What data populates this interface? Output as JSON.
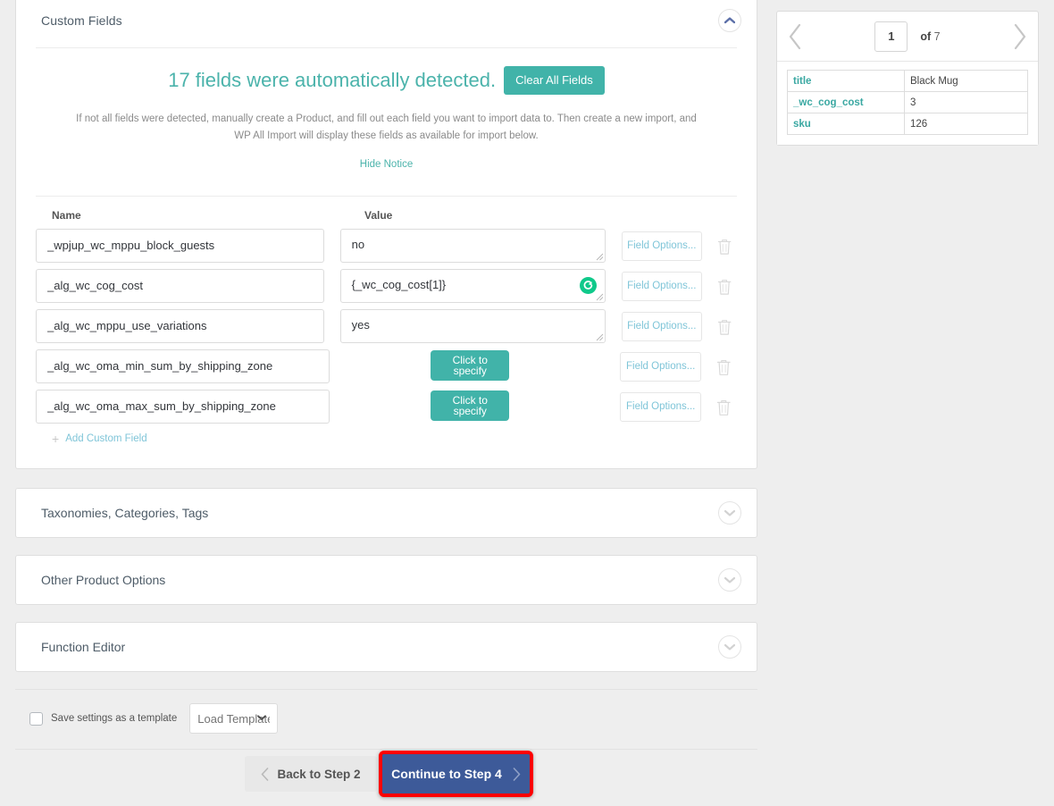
{
  "custom_fields_panel": {
    "title": "Custom Fields",
    "toggle_icon": "chevron-up-icon",
    "notice": {
      "headline": "17 fields were automatically detected.",
      "clear_button": "Clear All Fields",
      "body": "If not all fields were detected, manually create a Product, and fill out each field you want to import data to. Then create a new import, and WP All Import will display these fields as available for import below.",
      "hide_link": "Hide Notice"
    },
    "columns": {
      "name": "Name",
      "value": "Value"
    },
    "rows": [
      {
        "name": "_wpjup_wc_mppu_block_guests",
        "value_type": "textarea",
        "value": "no",
        "has_green_badge": false,
        "options_label": "Field Options...",
        "delete_icon": "trash-icon"
      },
      {
        "name": "_alg_wc_cog_cost",
        "value_type": "textarea",
        "value": "{_wc_cog_cost[1]}",
        "has_green_badge": true,
        "options_label": "Field Options...",
        "delete_icon": "trash-icon"
      },
      {
        "name": "_alg_wc_mppu_use_variations",
        "value_type": "textarea",
        "value": "yes",
        "has_green_badge": false,
        "options_label": "Field Options...",
        "delete_icon": "trash-icon"
      },
      {
        "name": "_alg_wc_oma_min_sum_by_shipping_zone",
        "value_type": "button",
        "value": "Click to specify",
        "has_green_badge": false,
        "options_label": "Field Options...",
        "delete_icon": "trash-icon"
      },
      {
        "name": "_alg_wc_oma_max_sum_by_shipping_zone",
        "value_type": "button",
        "value": "Click to specify",
        "has_green_badge": false,
        "options_label": "Field Options...",
        "delete_icon": "trash-icon"
      }
    ],
    "add_field_label": "Add Custom Field"
  },
  "collapsed_panels": [
    {
      "title": "Taxonomies, Categories, Tags",
      "toggle_icon": "chevron-down-icon"
    },
    {
      "title": "Other Product Options",
      "toggle_icon": "chevron-down-icon"
    },
    {
      "title": "Function Editor",
      "toggle_icon": "chevron-down-icon"
    }
  ],
  "template_bar": {
    "checkbox_label": "Save settings as a template",
    "load_template_placeholder": "Load Template...",
    "caret_icon": "chevron-down-icon"
  },
  "footer": {
    "back_label": "Back to Step 2",
    "back_icon": "chevron-left-icon",
    "continue_label": "Continue to Step 4",
    "continue_icon": "chevron-right-icon",
    "highlight_color": "#ff0000",
    "continue_color": "#3d5a99"
  },
  "preview_sidebar": {
    "prev_icon": "chevron-left-icon",
    "next_icon": "chevron-right-icon",
    "page_value": "1",
    "of_label_bold": "of",
    "of_label_count": "7",
    "rows": [
      {
        "key": "title",
        "value": "Black Mug"
      },
      {
        "key": "_wc_cog_cost",
        "value": "3"
      },
      {
        "key": "sku",
        "value": "126"
      }
    ]
  },
  "colors": {
    "teal": "#41b3a9",
    "teal_text": "#4bb3ab",
    "link_blue": "#7fc5d8",
    "green_badge": "#0fc98a",
    "page_bg": "#eeeeee"
  }
}
